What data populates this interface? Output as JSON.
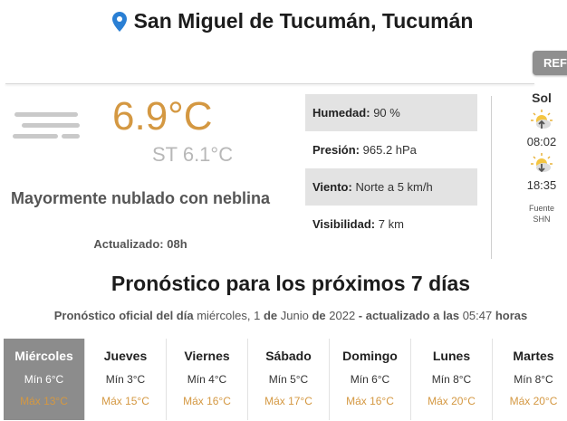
{
  "location": {
    "title": "San Miguel de Tucumán, Tucumán"
  },
  "refresh_label": "REF",
  "current": {
    "temperature": "6.9°C",
    "feels_like": "ST 6.1°C",
    "description": "Mayormente nublado con neblina",
    "updated": "Actualizado: 08h",
    "icon": "fog-icon"
  },
  "stats": [
    {
      "label": "Humedad:",
      "value": "90 %"
    },
    {
      "label": "Presión:",
      "value": "965.2 hPa"
    },
    {
      "label": "Viento:",
      "value": "Norte a 5 km/h"
    },
    {
      "label": "Visibilidad:",
      "value": "7 km"
    }
  ],
  "sun": {
    "heading": "Sol",
    "sunrise": "08:02",
    "sunset": "18:35",
    "source_label": "Fuente",
    "source": "SHN"
  },
  "forecast": {
    "title": "Pronóstico para los próximos 7 días",
    "sub_prefix": "Pronóstico oficial del día",
    "sub_weekday": "miércoles,",
    "sub_day": "1",
    "sub_de1": "de",
    "sub_month": "Junio",
    "sub_de2": "de",
    "sub_year": "2022",
    "sub_updated": "- actualizado a las",
    "sub_time": "05:47",
    "sub_hours": "horas",
    "days": [
      {
        "name": "Miércoles",
        "min": "Mín 6°C",
        "max": "Máx 13°C",
        "active": true
      },
      {
        "name": "Jueves",
        "min": "Mín 3°C",
        "max": "Máx 15°C"
      },
      {
        "name": "Viernes",
        "min": "Mín 4°C",
        "max": "Máx 16°C"
      },
      {
        "name": "Sábado",
        "min": "Mín 5°C",
        "max": "Máx 17°C"
      },
      {
        "name": "Domingo",
        "min": "Mín 6°C",
        "max": "Máx 16°C"
      },
      {
        "name": "Lunes",
        "min": "Mín 8°C",
        "max": "Máx 20°C"
      },
      {
        "name": "Martes",
        "min": "Mín 8°C",
        "max": "Máx 20°C"
      }
    ]
  },
  "colors": {
    "accent": "#d49842",
    "pin": "#2a7fd4",
    "active_day": "#8c8c8c",
    "shade": "#e3e3e3"
  }
}
